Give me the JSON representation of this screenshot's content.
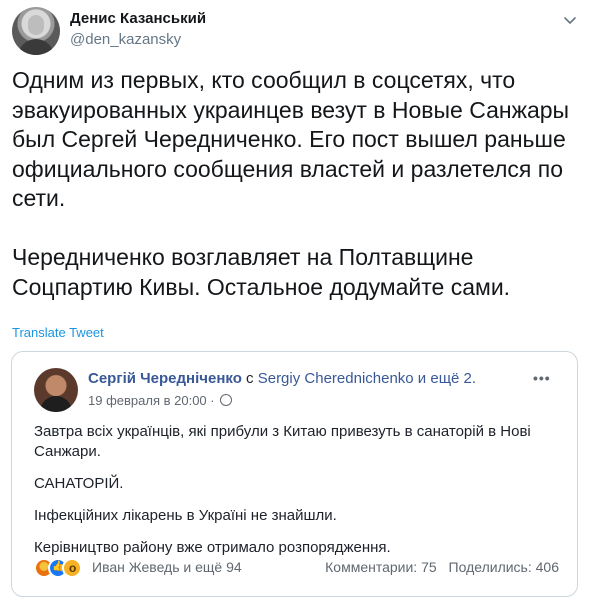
{
  "tweet": {
    "author_name": "Денис Казанський",
    "author_handle": "@den_kazansky",
    "text_lines": [
      "Одним из первых, кто сообщил в соцсетях, что",
      "эвакуированных украинцев везут в Новые Санжары",
      "был Сергей Чередниченко. Его пост вышел раньше",
      "официального сообщения властей и разлетелся по",
      "сети.",
      "Чередниченко возглавляет на Полтавщине",
      "Соцпартию Кивы. Остальное додумайте сами."
    ],
    "translate_label": "Translate Tweet"
  },
  "fb_post": {
    "author": "Сергій Чередніченко",
    "with_word": "с",
    "tagged": "Sergiy Cherednichenko и ещё 2.",
    "date": "19 февраля в 20:00 ·",
    "body": [
      "Завтра всіх українців, які прибули з Китаю привезуть в санаторій в Нові Санжари.",
      "САНАТОРІЙ.",
      "Інфекційних лікарень в Україні не знайшли.",
      "Керівництво району вже отримало розпорядження."
    ],
    "reactions_text": "Иван Жеведь и ещё 94",
    "comments": "Комментарии: 75",
    "shares": "Поделились: 406"
  },
  "icons": {
    "more": "chevron-down-icon",
    "fb_more": "more-dots-icon",
    "privacy": "globe-icon",
    "reactions": [
      "angry-reaction-icon",
      "like-reaction-icon",
      "wow-reaction-icon"
    ]
  },
  "colors": {
    "link": "#1b95e0",
    "fb_link": "#385898",
    "secondary": "#657786"
  }
}
